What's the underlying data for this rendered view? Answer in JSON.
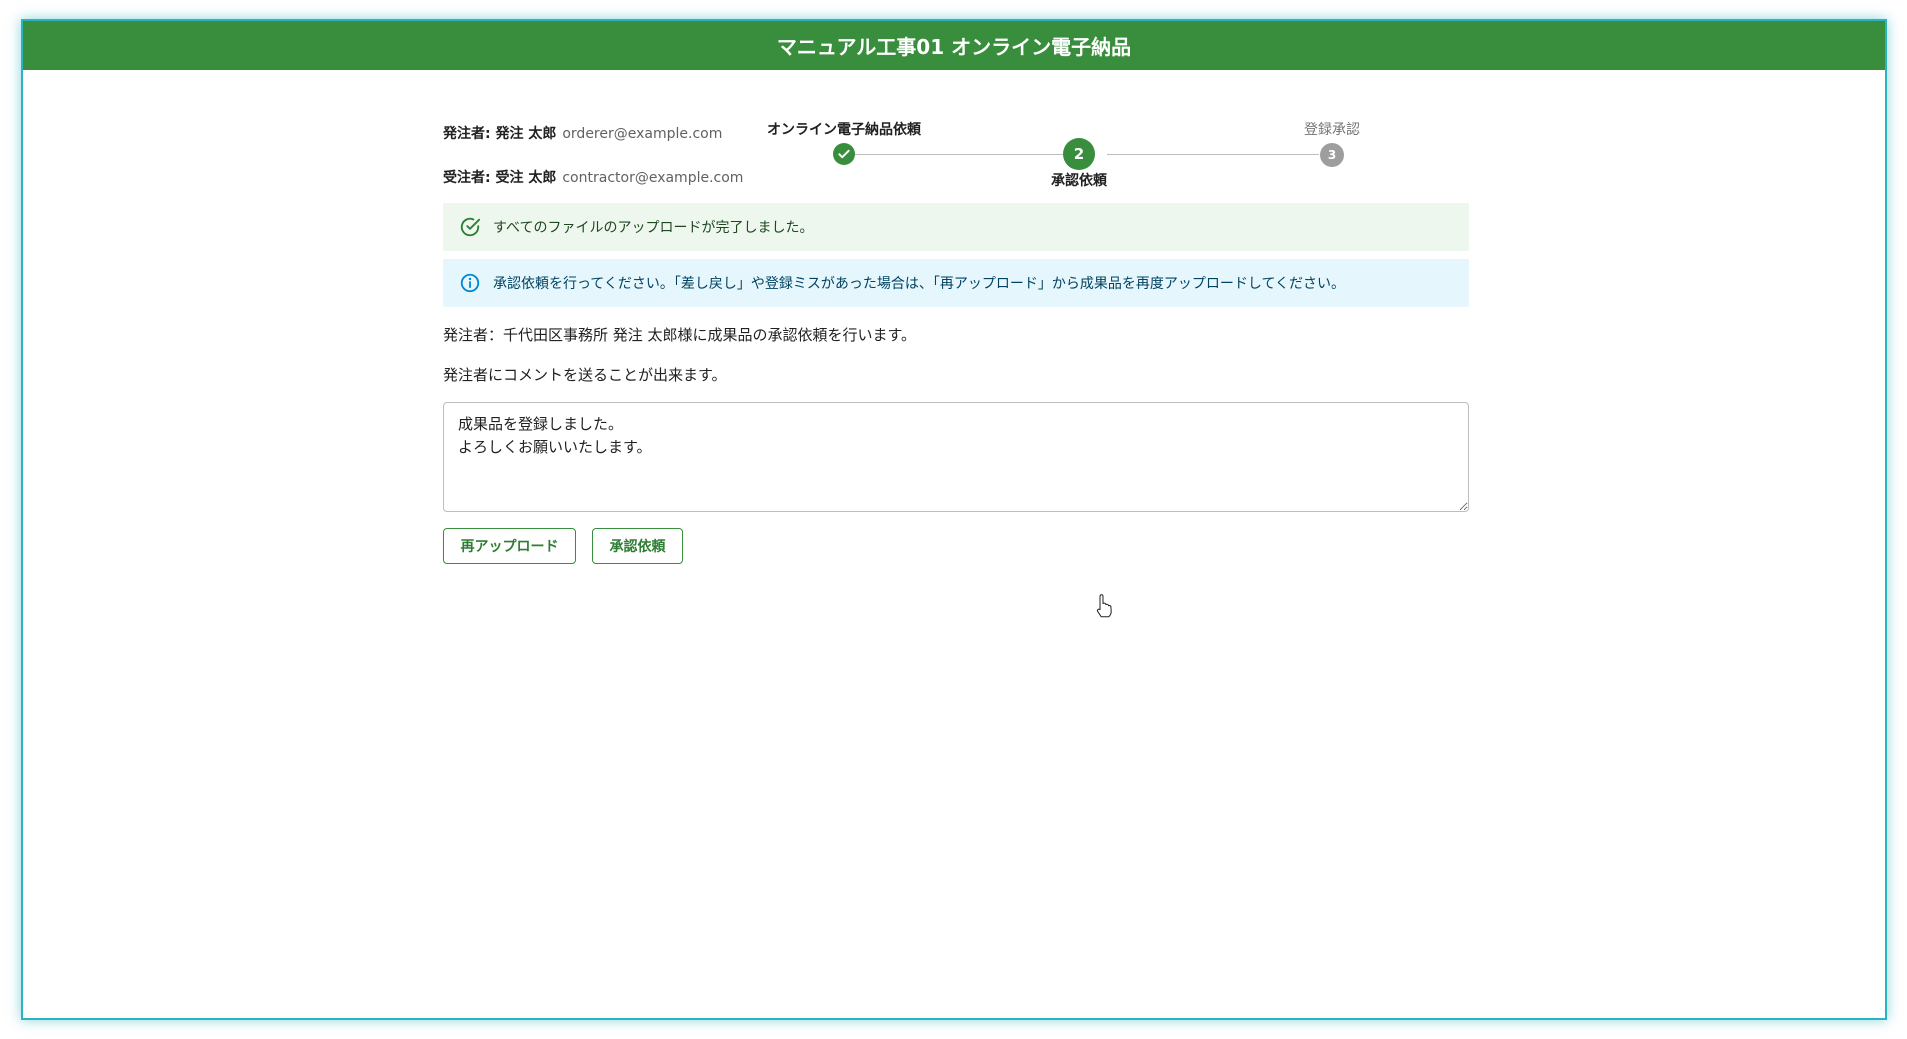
{
  "title": "マニュアル工事01 オンライン電子納品",
  "parties": {
    "orderer_label": "発注者: 発注 太郎",
    "orderer_email": "orderer@example.com",
    "contractor_label": "受注者: 受注 太郎",
    "contractor_email": "contractor@example.com"
  },
  "stepper": {
    "steps": [
      {
        "label": "オンライン電子納品依頼",
        "number": "1",
        "status": "completed"
      },
      {
        "label": "承認依頼",
        "number": "2",
        "status": "active"
      },
      {
        "label": "登録承認",
        "number": "3",
        "status": "pending"
      }
    ]
  },
  "alerts": {
    "success": {
      "text": "すべてのファイルのアップロードが完了しました。",
      "icon": "check-circle-icon"
    },
    "info": {
      "text": "承認依頼を行ってください。「差し戻し」や登録ミスがあった場合は、「再アップロード」から成果品を再度アップロードしてください。",
      "icon": "info-icon"
    }
  },
  "message1": "発注者：千代田区事務所 発注 太郎様に成果品の承認依頼を行います。",
  "message2": "発注者にコメントを送ることが出来ます。",
  "comment": "成果品を登録しました。\nよろしくお願いいたします。",
  "buttons": {
    "reupload": "再アップロード",
    "request_approval": "承認依頼"
  },
  "colors": {
    "primary": "#388e3c",
    "success_bg": "#edf7ed",
    "info_bg": "#e5f6fd",
    "step_pending": "#9e9e9e"
  }
}
